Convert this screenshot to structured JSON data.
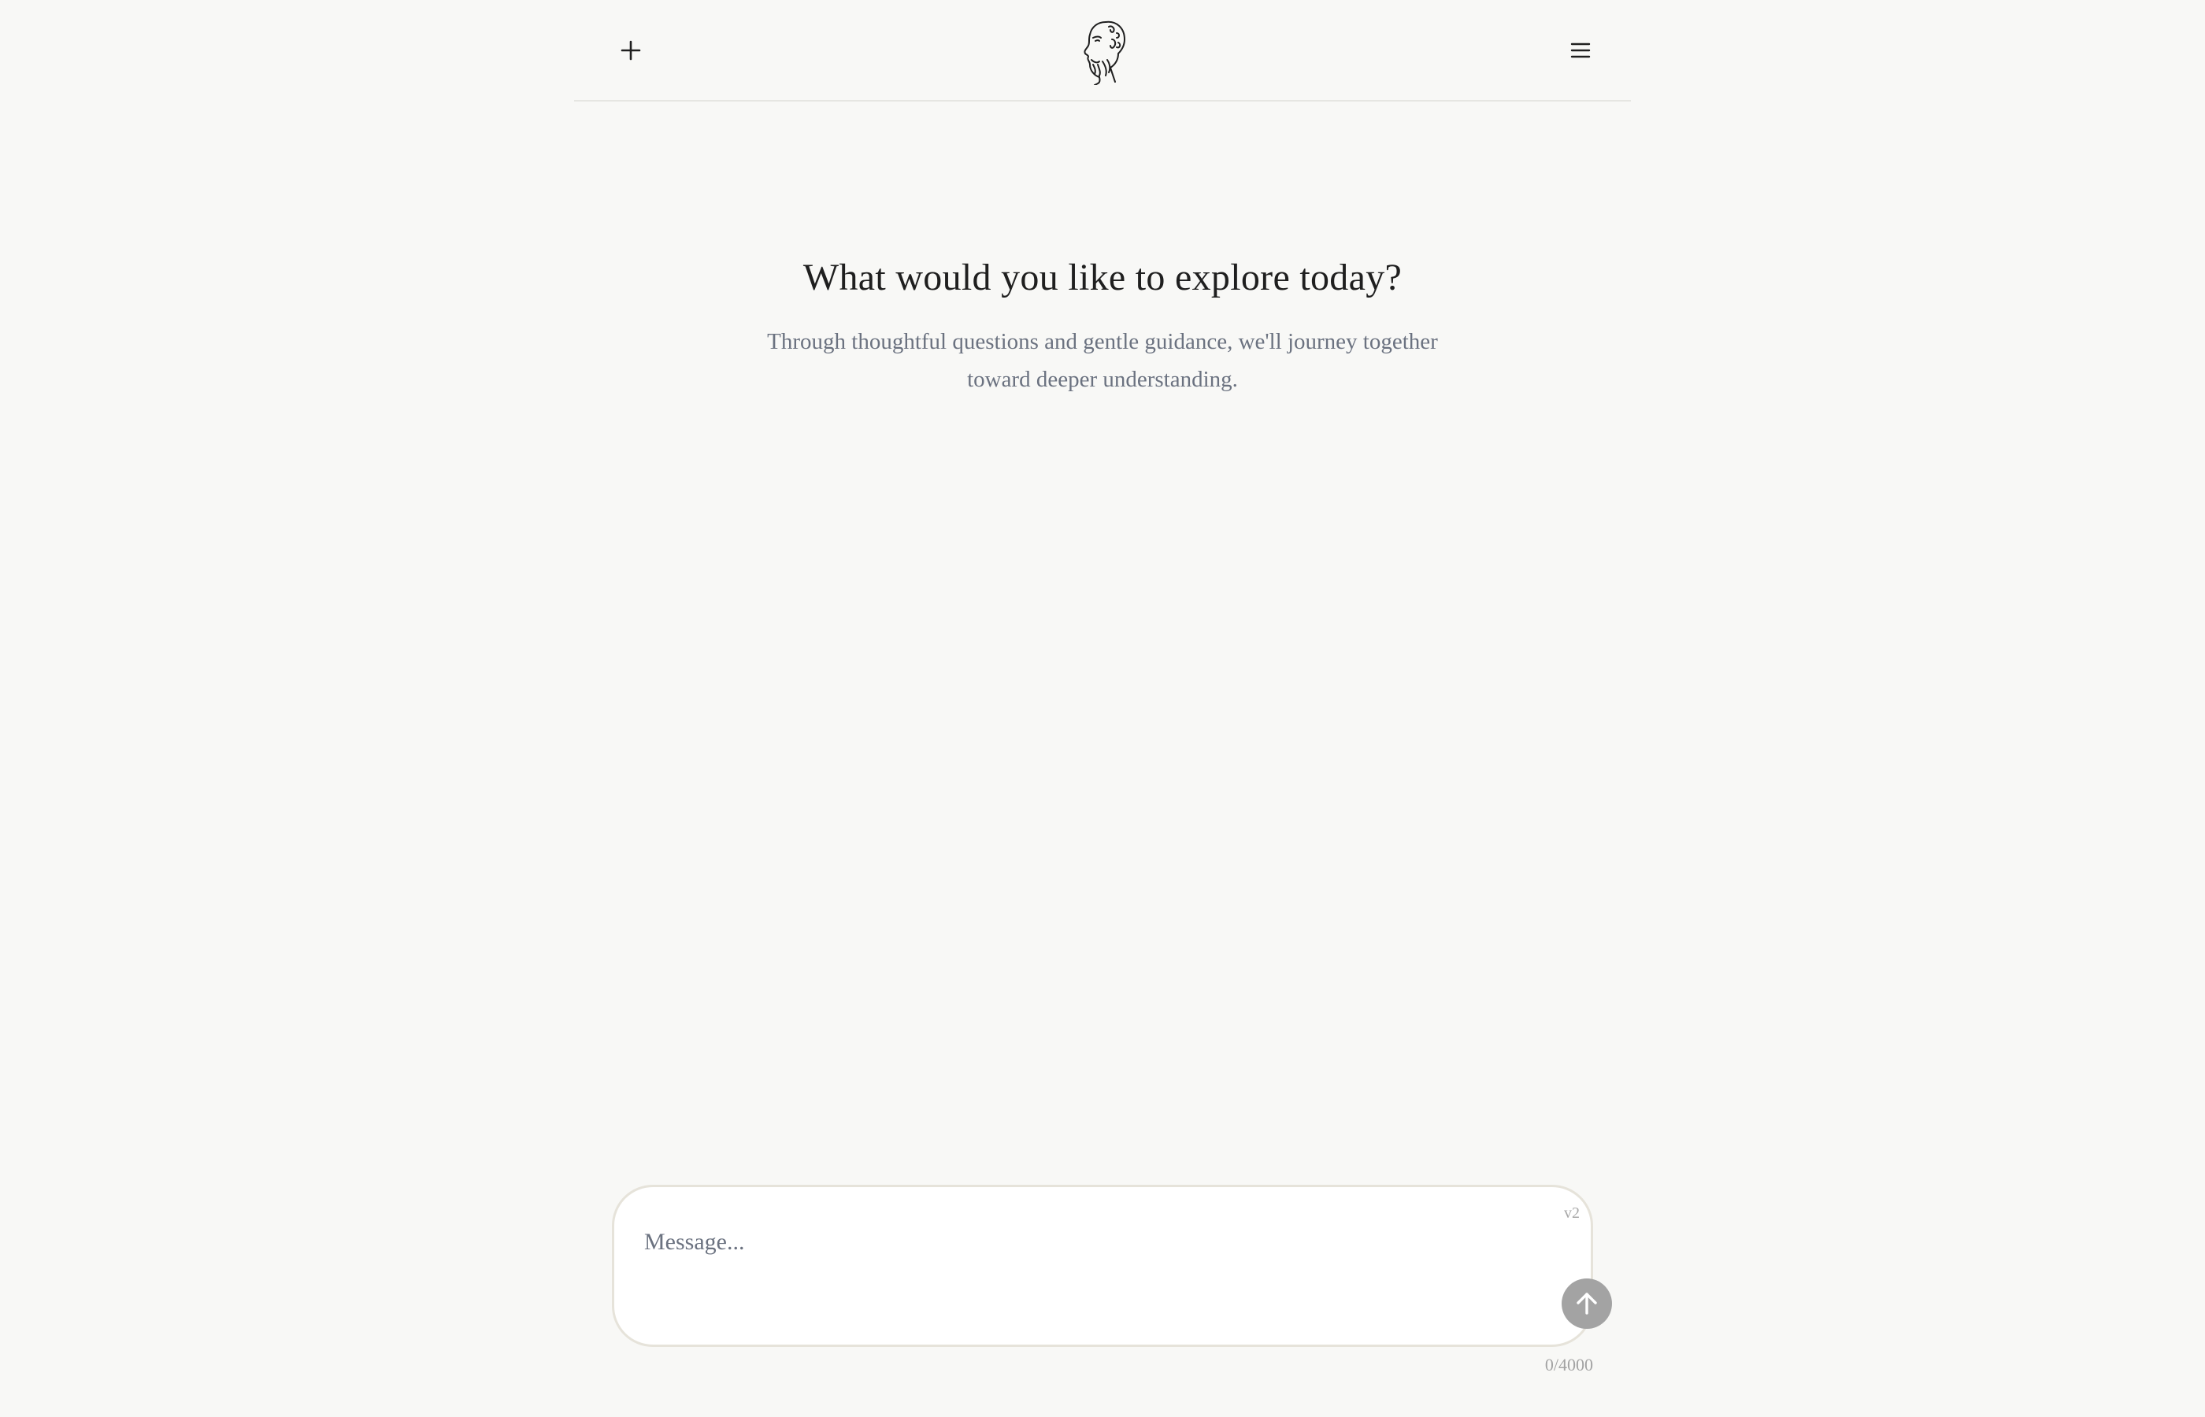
{
  "header": {
    "new_chat_icon": "plus-icon",
    "logo_icon": "philosopher-head-logo",
    "menu_icon": "hamburger-menu-icon"
  },
  "hero": {
    "title": "What would you like to explore today?",
    "subtitle": "Through thoughtful questions and gentle guidance, we'll journey together toward deeper understanding."
  },
  "composer": {
    "placeholder": "Message...",
    "value": "",
    "version": "v2",
    "send_icon": "arrow-up-icon",
    "char_count": "0/4000"
  },
  "colors": {
    "background": "#f8f8f6",
    "composer_border": "#e6e3da",
    "send_button": "#a3a3a3",
    "subtitle_text": "#6b7280"
  }
}
